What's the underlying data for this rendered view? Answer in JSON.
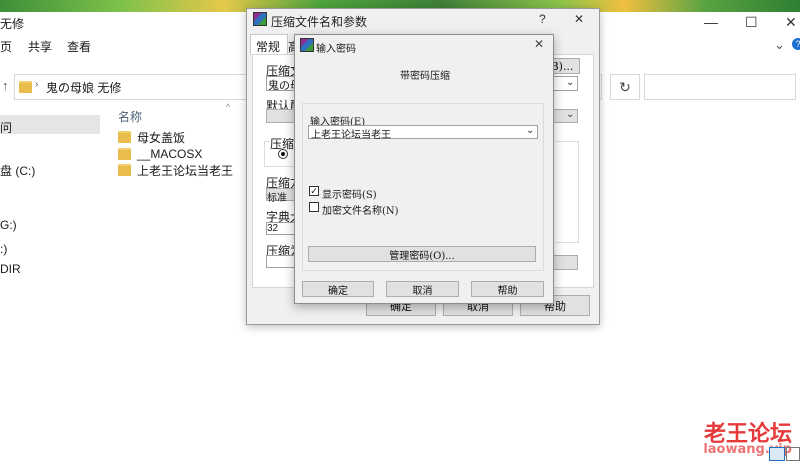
{
  "window": {
    "title": "无修",
    "min": "—",
    "max": "☐",
    "close": "✕",
    "help": "?"
  },
  "ribbon": {
    "tabs": [
      "页",
      "共享",
      "查看"
    ],
    "expand": "⌄"
  },
  "address": {
    "back": "↑",
    "path": "鬼の母娘 无修",
    "refresh": "↻"
  },
  "nav": {
    "items": [
      "问",
      "盘 (C:)",
      "G:)",
      ":)",
      "DIR"
    ]
  },
  "files": {
    "column": "名称",
    "items": [
      "母女盖饭",
      "__MACOSX",
      "上老王论坛当老王"
    ]
  },
  "archive_dialog": {
    "title": "压缩文件名和参数",
    "help": "?",
    "close": "✕",
    "tabs": [
      "常规",
      "高"
    ],
    "archive_name_label": "压缩文",
    "archive_name_value": "鬼の母",
    "browse_label": "B)...",
    "profile_label": "默认配",
    "format_label": "压缩文",
    "method_label": "压缩方",
    "method_value": "标准",
    "dict_label": "字典大",
    "dict_value": "32",
    "split_label": "压缩为",
    "ok": "确定",
    "cancel": "取消",
    "help_button": "帮助"
  },
  "password_dialog": {
    "title": "输入密码",
    "close": "✕",
    "heading": "带密码压缩",
    "password_label": "输入密码(E)",
    "password_value": "上老王论坛当老王",
    "show_password_label": "显示密码(S)",
    "show_password_checked": true,
    "encrypt_names_label": "加密文件名称(N)",
    "encrypt_names_checked": false,
    "manage_button": "管理密码(O)...",
    "ok": "确定",
    "cancel": "取消",
    "help_button": "帮助"
  },
  "watermark": {
    "line1": "老王论坛",
    "line2": "laowang.vip"
  }
}
